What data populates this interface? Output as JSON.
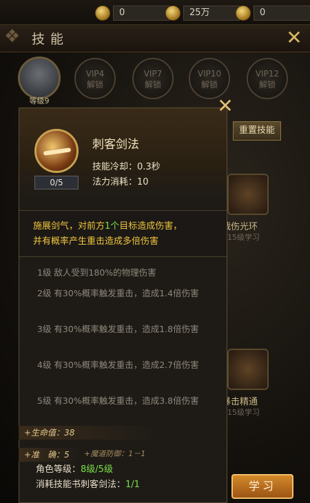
{
  "currency": {
    "gold": "0",
    "silver": "25万",
    "ingot": "0"
  },
  "header": {
    "title": "技能"
  },
  "player": {
    "level_label": "等级9"
  },
  "vip_slots": [
    {
      "line1": "VIP4",
      "line2": "解锁"
    },
    {
      "line1": "VIP7",
      "line2": "解锁"
    },
    {
      "line1": "VIP10",
      "line2": "解锁"
    },
    {
      "line1": "VIP12",
      "line2": "解锁"
    }
  ],
  "reset_button": "重置技能",
  "background_skills": [
    {
      "name": "戟伤光环",
      "sub": "15级学习"
    },
    {
      "name": "暴击精通",
      "sub": "15级学习"
    }
  ],
  "popup": {
    "skill_name": "刺客剑法",
    "level_progress": "0/5",
    "cooldown": "技能冷却：0.3秒",
    "mana_cost": "法力消耗：10",
    "description_part1": "施展剑气，对前方",
    "description_count": "1个",
    "description_part2": "目标造成伤害，",
    "description_line2": "并有概率产生重击造成多倍伤害",
    "levels": [
      "1级 敌人受到180%的物理伤害",
      "2级 有30%概率触发重击，造成1.4倍伤害",
      "3级 有30%概率触发重击，造成1.8倍伤害",
      "4级 有30%概率触发重击，造成2.7倍伤害",
      "5级 有30%概率触发重击，造成3.8倍伤害"
    ]
  },
  "bottom": {
    "stat1": "+生命值：38",
    "stat2": "+准　确：5",
    "stat3": "+魔道防御：1－1",
    "req_level_label": "角色等级：",
    "req_level_value": "8级/5级",
    "book_label": "消耗技能书刺客剑法：",
    "book_value": "1/1",
    "learn_button": "学习"
  }
}
